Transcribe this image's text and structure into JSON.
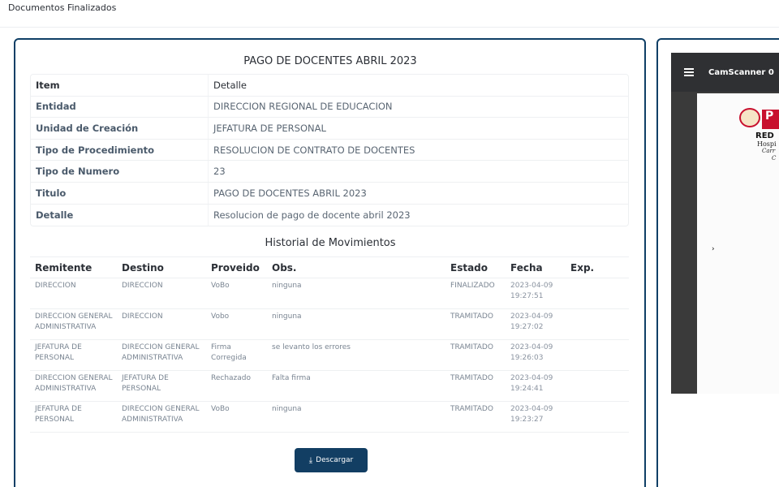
{
  "header": {
    "breadcrumb": "Documentos Finalizados"
  },
  "document": {
    "title": "PAGO DE DOCENTES ABRIL 2023",
    "detail_header": {
      "key": "Item",
      "value": "Detalle"
    },
    "details": [
      {
        "key": "Entidad",
        "value": "DIRECCION REGIONAL DE EDUCACION"
      },
      {
        "key": "Unidad de Creación",
        "value": "JEFATURA DE PERSONAL"
      },
      {
        "key": "Tipo de Procedimiento",
        "value": "RESOLUCION DE CONTRATO DE DOCENTES"
      },
      {
        "key": "Tipo de Numero",
        "value": "23"
      },
      {
        "key": "Titulo",
        "value": "PAGO DE DOCENTES ABRIL 2023"
      },
      {
        "key": "Detalle",
        "value": "Resolucion de pago de docente abril 2023"
      }
    ]
  },
  "history": {
    "title": "Historial de Movimientos",
    "columns": [
      "Remitente",
      "Destino",
      "Proveido",
      "Obs.",
      "Estado",
      "Fecha",
      "Exp."
    ],
    "rows": [
      {
        "remitente": "DIRECCION",
        "destino": "DIRECCION",
        "proveido": "VoBo",
        "obs": "ninguna",
        "estado": "FINALIZADO",
        "fecha": "2023-04-09 19:27:51",
        "exp": ""
      },
      {
        "remitente": "DIRECCION GENERAL ADMINISTRATIVA",
        "destino": "DIRECCION",
        "proveido": "Vobo",
        "obs": "ninguna",
        "estado": "TRAMITADO",
        "fecha": "2023-04-09 19:27:02",
        "exp": ""
      },
      {
        "remitente": "JEFATURA DE PERSONAL",
        "destino": "DIRECCION GENERAL ADMINISTRATIVA",
        "proveido": "Firma Corregida",
        "obs": "se levanto los errores",
        "estado": "TRAMITADO",
        "fecha": "2023-04-09 19:26:03",
        "exp": ""
      },
      {
        "remitente": "DIRECCION GENERAL ADMINISTRATIVA",
        "destino": "JEFATURA DE PERSONAL",
        "proveido": "Rechazado",
        "obs": "Falta firma",
        "estado": "TRAMITADO",
        "fecha": "2023-04-09 19:24:41",
        "exp": ""
      },
      {
        "remitente": "JEFATURA DE PERSONAL",
        "destino": "DIRECCION GENERAL ADMINISTRATIVA",
        "proveido": "VoBo",
        "obs": "ninguna",
        "estado": "TRAMITADO",
        "fecha": "2023-04-09 19:23:27",
        "exp": ""
      }
    ]
  },
  "actions": {
    "download_label": "Descargar",
    "download_icon": "download-icon"
  },
  "viewer": {
    "filename": "CamScanner 0",
    "menu_icon": "hamburger-menu-icon",
    "page_text": [
      "RED",
      "Hospi",
      "Carr",
      "C"
    ],
    "mark": "›"
  },
  "colors": {
    "accent": "#123e63",
    "card_border": "#0f3f66",
    "viewer_bar": "#2f3033"
  }
}
